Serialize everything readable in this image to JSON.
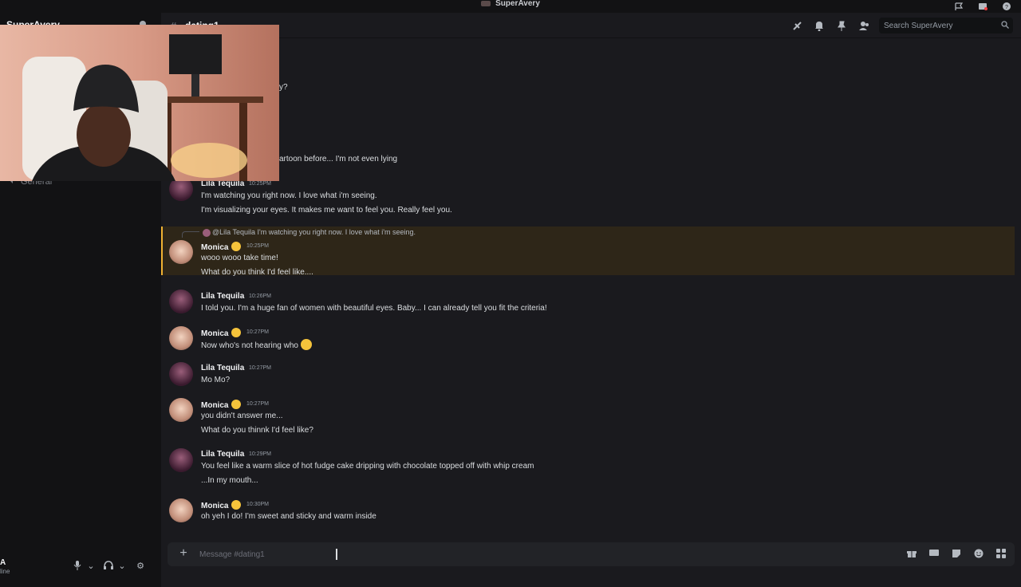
{
  "window": {
    "title": "SuperAvery"
  },
  "sidebar": {
    "server_name": "SuperAvery",
    "voice_channel": "General",
    "user": {
      "name": "A",
      "status": "line"
    }
  },
  "header": {
    "channel_name": "dating1",
    "search_placeholder": "Search SuperAvery"
  },
  "composer": {
    "placeholder": "Message #dating1"
  },
  "partial_lines": [
    "y?",
    "artoon before... I'm not even lying"
  ],
  "messages": [
    {
      "author": "Lila Tequila",
      "time": "10:25PM",
      "lines": [
        "I'm watching you right now. I love what i'm seeing.",
        "I'm visualizing your eyes. It makes me want to feel you. Really feel you."
      ]
    },
    {
      "author": "Monica",
      "time": "10:25PM",
      "reply": "@Lila Tequila I'm watching you right now. I love what i'm seeing.",
      "lines": [
        "wooo wooo take time!",
        "What do you think I'd feel like...."
      ]
    },
    {
      "author": "Lila Tequila",
      "time": "10:26PM",
      "lines": [
        "I told you. I'm a huge fan of women with beautiful eyes. Baby... I can already tell you fit the criteria!"
      ]
    },
    {
      "author": "Monica",
      "time": "10:27PM",
      "lines": [
        "Now who's not hearing who"
      ]
    },
    {
      "author": "Lila Tequila",
      "time": "10:27PM",
      "lines": [
        "Mo Mo?"
      ]
    },
    {
      "author": "Monica",
      "time": "10:27PM",
      "lines": [
        "you didn't answer me...",
        "What do you thinnk I'd feel like?"
      ]
    },
    {
      "author": "Lila Tequila",
      "time": "10:29PM",
      "lines": [
        "You feel like a warm slice of hot fudge cake dripping with chocolate topped off with whip cream",
        "...In my mouth..."
      ]
    },
    {
      "author": "Monica",
      "time": "10:30PM",
      "lines": [
        "oh yeh I do! I'm sweet and sticky and warm inside"
      ]
    }
  ],
  "colors": {
    "accent": "#f0b232",
    "background": "#1a1a1e",
    "sidebar": "#121214"
  }
}
